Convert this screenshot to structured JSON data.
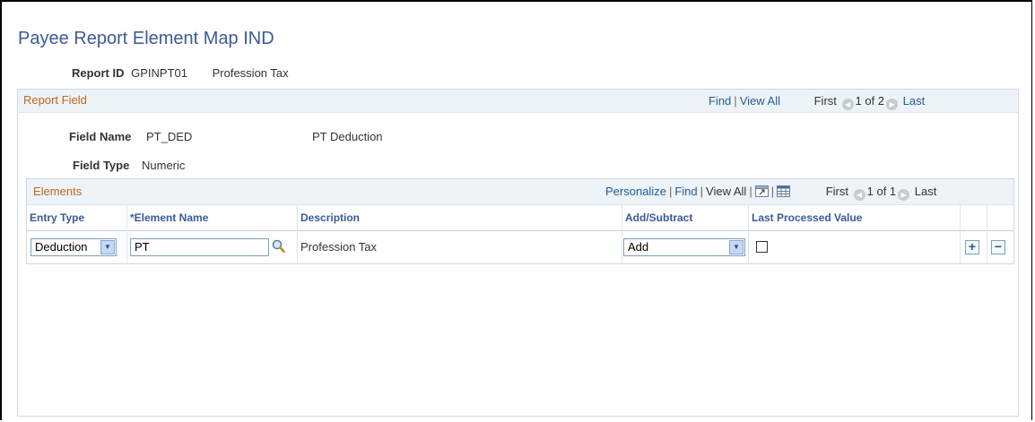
{
  "page": {
    "title": "Payee Report Element Map IND"
  },
  "report": {
    "id_label": "Report ID",
    "id_value": "GPINPT01",
    "description": "Profession Tax"
  },
  "report_field": {
    "title": "Report Field",
    "nav": {
      "find": "Find",
      "view_all": "View All",
      "first": "First",
      "position": "1 of 2",
      "last": "Last"
    },
    "field_name_label": "Field Name",
    "field_name_value": "PT_DED",
    "field_name_desc": "PT Deduction",
    "field_type_label": "Field Type",
    "field_type_value": "Numeric"
  },
  "elements": {
    "title": "Elements",
    "nav": {
      "personalize": "Personalize",
      "find": "Find",
      "view_all": "View All",
      "first": "First",
      "position": "1 of 1",
      "last": "Last"
    },
    "columns": [
      "Entry Type",
      "*Element Name",
      "Description",
      "Add/Subtract",
      "Last Processed Value"
    ],
    "rows": [
      {
        "entry_type": "Deduction",
        "element_name": "PT",
        "description": "Profession Tax",
        "add_subtract": "Add",
        "last_processed": false
      }
    ]
  },
  "icons": {
    "lookup": "magnifier-icon",
    "zoom": "zoom-grid-icon",
    "download": "download-excel-icon",
    "add_row": "plus-icon",
    "delete_row": "minus-icon",
    "prev": "left-arrow-icon",
    "next": "right-arrow-icon"
  },
  "colors": {
    "title": "#3b5998",
    "group_title": "#c0651c",
    "link": "#1f5c99"
  }
}
